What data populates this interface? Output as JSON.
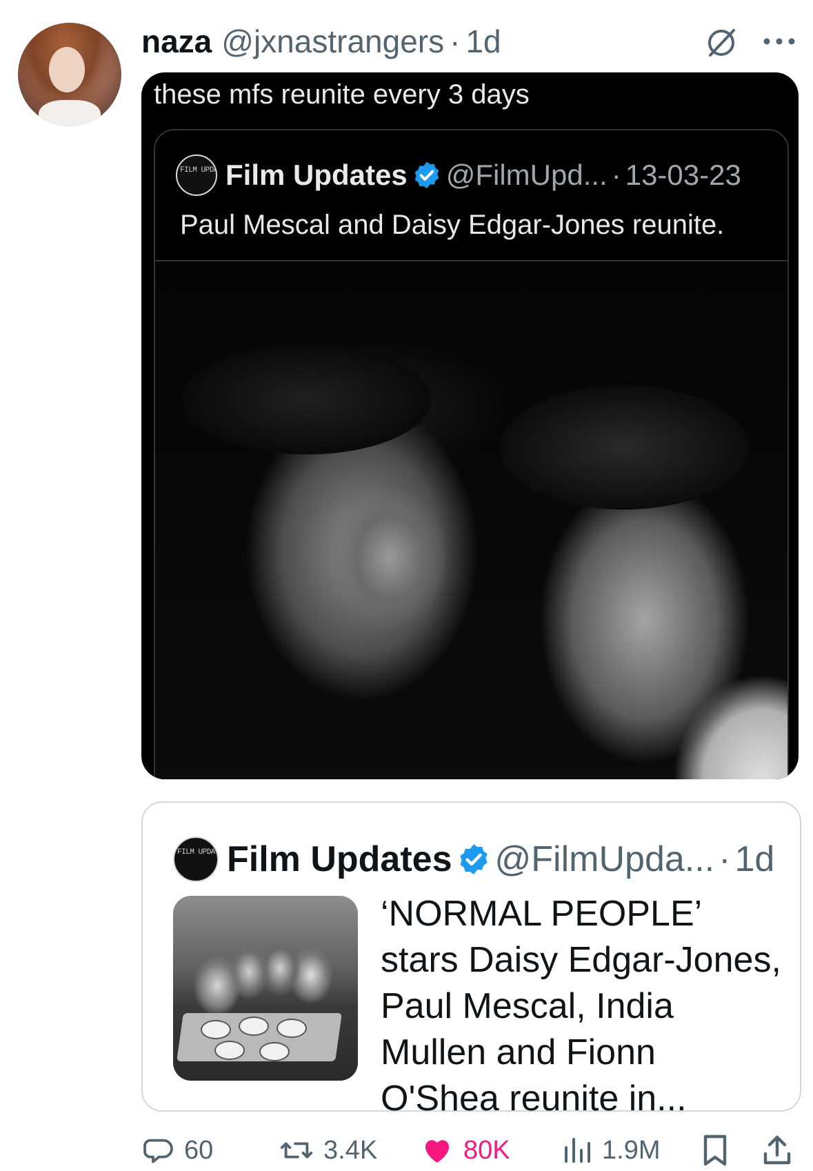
{
  "post": {
    "author_name": "naza",
    "author_handle": "@jxnastrangers",
    "separator": "·",
    "time": "1d",
    "text": "these mfs reunite every 3 days"
  },
  "inner_quote": {
    "logo_text": "FILM UPDATES",
    "author_name": "Film Updates",
    "author_handle": "@FilmUpd...",
    "separator": "·",
    "date": "13-03-23",
    "text": "Paul Mescal and Daisy Edgar-Jones reunite."
  },
  "quote": {
    "logo_text": "FILM UPDATES",
    "author_name": "Film Updates",
    "author_handle": "@FilmUpda...",
    "separator": "·",
    "time": "1d",
    "text": "‘NORMAL PEOPLE’ stars Daisy Edgar-Jones, Paul Mescal, India Mullen and Fionn O'Shea reunite in..."
  },
  "actions": {
    "replies": "60",
    "reposts": "3.4K",
    "likes": "80K",
    "views": "1.9M"
  },
  "colors": {
    "verified": "#1d9bf0",
    "like": "#f91880",
    "muted": "#536471",
    "dark_card": "#000000"
  },
  "icons": [
    "hide-icon",
    "more-icon",
    "verified-badge-icon",
    "reply-icon",
    "repost-icon",
    "like-icon",
    "views-icon",
    "bookmark-icon",
    "share-icon"
  ]
}
